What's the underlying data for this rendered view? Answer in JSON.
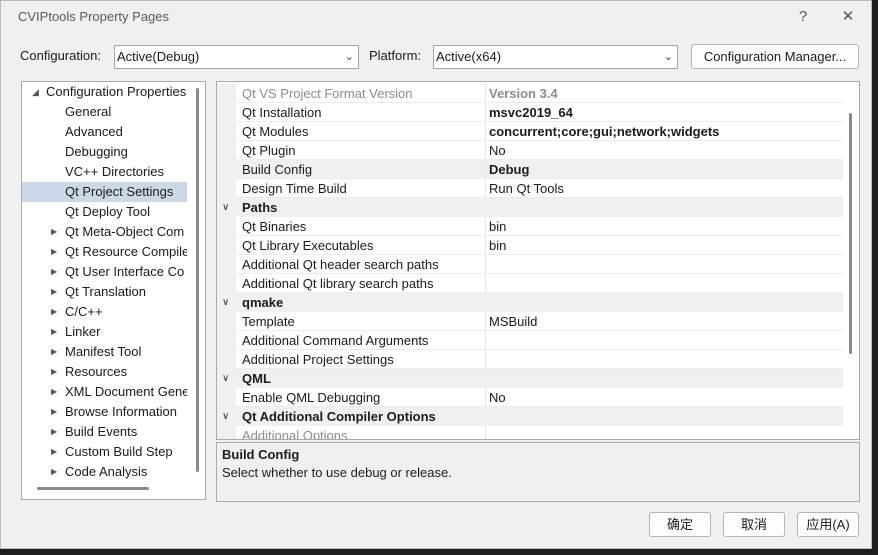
{
  "window": {
    "title": "CVIPtools Property Pages",
    "help_label": "?",
    "close_label": "✕"
  },
  "toolbar": {
    "configuration_label": "Configuration:",
    "configuration_value": "Active(Debug)",
    "platform_label": "Platform:",
    "platform_value": "Active(x64)",
    "config_manager_label": "Configuration Manager..."
  },
  "tree": {
    "root": "Configuration Properties",
    "items": [
      {
        "label": "General",
        "expandable": false
      },
      {
        "label": "Advanced",
        "expandable": false
      },
      {
        "label": "Debugging",
        "expandable": false
      },
      {
        "label": "VC++ Directories",
        "expandable": false
      },
      {
        "label": "Qt Project Settings",
        "expandable": false,
        "selected": true
      },
      {
        "label": "Qt Deploy Tool",
        "expandable": false
      },
      {
        "label": "Qt Meta-Object Com",
        "expandable": true
      },
      {
        "label": "Qt Resource Compile",
        "expandable": true
      },
      {
        "label": "Qt User Interface Co",
        "expandable": true
      },
      {
        "label": "Qt Translation",
        "expandable": true
      },
      {
        "label": "C/C++",
        "expandable": true
      },
      {
        "label": "Linker",
        "expandable": true
      },
      {
        "label": "Manifest Tool",
        "expandable": true
      },
      {
        "label": "Resources",
        "expandable": true
      },
      {
        "label": "XML Document Gene",
        "expandable": true
      },
      {
        "label": "Browse Information",
        "expandable": true
      },
      {
        "label": "Build Events",
        "expandable": true
      },
      {
        "label": "Custom Build Step",
        "expandable": true
      },
      {
        "label": "Code Analysis",
        "expandable": true
      }
    ]
  },
  "grid": {
    "rows": [
      {
        "type": "prop",
        "name": "Qt VS Project Format Version",
        "value": "Version 3.4",
        "bold": true,
        "dim": true
      },
      {
        "type": "prop",
        "name": "Qt Installation",
        "value": "msvc2019_64",
        "bold": true
      },
      {
        "type": "prop",
        "name": "Qt Modules",
        "value": "concurrent;core;gui;network;widgets",
        "bold": true
      },
      {
        "type": "prop",
        "name": "Qt Plugin",
        "value": "No"
      },
      {
        "type": "prop",
        "name": "Build Config",
        "value": "Debug",
        "bold": true,
        "highlight": true
      },
      {
        "type": "prop",
        "name": "Design Time Build",
        "value": "Run Qt Tools"
      },
      {
        "type": "cat",
        "name": "Paths"
      },
      {
        "type": "prop",
        "name": "Qt Binaries",
        "value": "bin"
      },
      {
        "type": "prop",
        "name": "Qt Library Executables",
        "value": "bin"
      },
      {
        "type": "prop",
        "name": "Additional Qt header search paths",
        "value": ""
      },
      {
        "type": "prop",
        "name": "Additional Qt library search paths",
        "value": ""
      },
      {
        "type": "cat",
        "name": "qmake"
      },
      {
        "type": "prop",
        "name": "Template",
        "value": "MSBuild"
      },
      {
        "type": "prop",
        "name": "Additional Command Arguments",
        "value": ""
      },
      {
        "type": "prop",
        "name": "Additional Project Settings",
        "value": ""
      },
      {
        "type": "cat",
        "name": "QML"
      },
      {
        "type": "prop",
        "name": "Enable QML Debugging",
        "value": "No"
      },
      {
        "type": "cat",
        "name": "Qt Additional Compiler Options"
      },
      {
        "type": "prop",
        "name": "Additional Options",
        "value": "",
        "dim": true
      }
    ]
  },
  "description": {
    "title": "Build Config",
    "text": "Select whether to use debug or release."
  },
  "buttons": {
    "ok": "确定",
    "cancel": "取消",
    "apply": "应用(A)"
  },
  "icons": {
    "expand_collapsed": "triangle-right-icon",
    "expand_open": "triangle-down-icon",
    "category_chevron": "chevron-down-icon",
    "dropdown": "chevron-down-icon"
  },
  "colors": {
    "selection": "#ccd8e8",
    "dialog_bg": "#f0f0f0",
    "editor_bg": "#1e1e1e"
  }
}
